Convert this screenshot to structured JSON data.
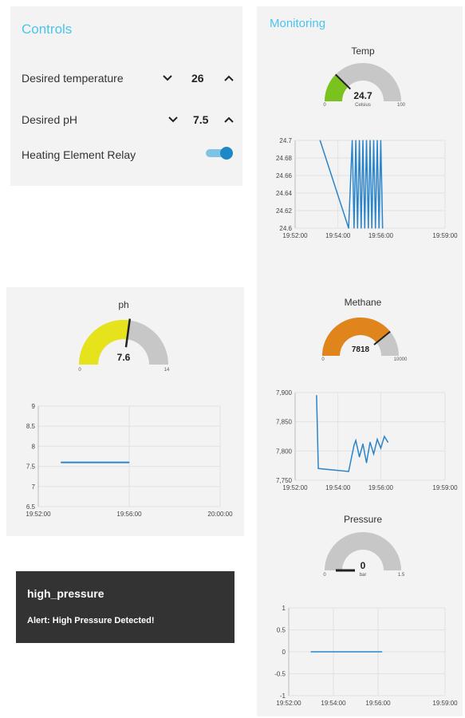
{
  "controls": {
    "title": "Controls",
    "desired_temperature": {
      "label": "Desired temperature",
      "value": "26"
    },
    "desired_ph": {
      "label": "Desired pH",
      "value": "7.5"
    },
    "heating_relay": {
      "label": "Heating Element Relay",
      "on": true
    }
  },
  "monitoring": {
    "title": "Monitoring",
    "temp_gauge": {
      "title": "Temp",
      "value": "24.7",
      "units": "Celsius",
      "min": "0",
      "max": "100",
      "level": 0.247
    },
    "methane_gauge": {
      "title": "Methane",
      "value": "7818",
      "min": "0",
      "max": "10000",
      "level": 0.7818
    },
    "pressure_gauge": {
      "title": "Pressure",
      "value": "0",
      "units": "bar",
      "min": "0",
      "max": "1.5",
      "level": 0.0
    }
  },
  "ph_panel": {
    "gauge": {
      "title": "ph",
      "value": "7.6",
      "min": "0",
      "max": "14",
      "level": 0.543
    }
  },
  "alert": {
    "title": "high_pressure",
    "message": "Alert: High Pressure Detected!"
  },
  "colors": {
    "accent": "#4dc3ee",
    "line": "#2b84c9",
    "gauge_track": "#c7c7c7",
    "temp_fill": "#7ac21e",
    "ph_fill": "#e6e21c",
    "methane_fill": "#e0841c",
    "alert_bg": "#333333"
  },
  "chart_data": [
    {
      "type": "line",
      "name": "temp-chart",
      "x": [
        "19:53:10",
        "19:54:30",
        "19:54:40",
        "19:54:45",
        "19:54:50",
        "19:54:55",
        "19:55:00",
        "19:55:05",
        "19:55:10",
        "19:55:15",
        "19:55:20",
        "19:55:25",
        "19:55:30",
        "19:55:35",
        "19:55:40",
        "19:55:45",
        "19:55:50",
        "19:55:55",
        "19:56:00",
        "19:56:05"
      ],
      "y": [
        24.7,
        24.6,
        24.7,
        24.6,
        24.7,
        24.6,
        24.7,
        24.6,
        24.7,
        24.6,
        24.7,
        24.6,
        24.7,
        24.6,
        24.7,
        24.6,
        24.7,
        24.6,
        24.7,
        24.6
      ],
      "ylim": [
        24.6,
        24.7
      ],
      "yticks": [
        "24.7",
        "24.68",
        "24.66",
        "24.64",
        "24.62",
        "24.6"
      ],
      "xticks": [
        "19:52:00",
        "19:54:00",
        "19:56:00",
        "19:59:00"
      ]
    },
    {
      "type": "line",
      "name": "ph-chart",
      "x": [
        "19:53:00",
        "19:56:00"
      ],
      "y": [
        7.6,
        7.6
      ],
      "ylim": [
        6.5,
        9
      ],
      "yticks": [
        "9",
        "8.5",
        "8",
        "7.5",
        "7",
        "6.5"
      ],
      "xticks": [
        "19:52:00",
        "19:56:00",
        "20:00:00"
      ]
    },
    {
      "type": "line",
      "name": "methane-chart",
      "x": [
        "19:53:00",
        "19:53:05",
        "19:54:30",
        "19:54:45",
        "19:54:50",
        "19:55:00",
        "19:55:10",
        "19:55:20",
        "19:55:30",
        "19:55:40",
        "19:55:50",
        "19:56:00",
        "19:56:10",
        "19:56:20"
      ],
      "y": [
        7895,
        7770,
        7765,
        7810,
        7818,
        7790,
        7812,
        7780,
        7815,
        7795,
        7820,
        7805,
        7825,
        7815
      ],
      "ylim": [
        7750,
        7900
      ],
      "yticks": [
        "7,900",
        "7,850",
        "7,800",
        "7,750"
      ],
      "xticks": [
        "19:52:00",
        "19:54:00",
        "19:56:00",
        "19:59:00"
      ]
    },
    {
      "type": "line",
      "name": "pressure-chart",
      "x": [
        "19:53:00",
        "19:56:10"
      ],
      "y": [
        0,
        0
      ],
      "ylim": [
        -1,
        1
      ],
      "yticks": [
        "1",
        "0.5",
        "0",
        "-0.5",
        "-1"
      ],
      "xticks": [
        "19:52:00",
        "19:54:00",
        "19:56:00",
        "19:59:00"
      ]
    }
  ]
}
